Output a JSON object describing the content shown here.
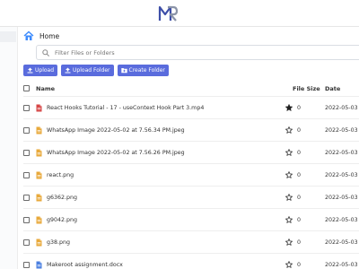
{
  "header": {
    "logo_text": "MR"
  },
  "breadcrumb": {
    "current": "Home"
  },
  "search": {
    "placeholder": "Filter Files or Folders"
  },
  "actions": {
    "upload": "Upload",
    "upload_folder": "Upload Folder",
    "create_folder": "Create Folder"
  },
  "table": {
    "headers": {
      "name": "Name",
      "size": "File Size",
      "date": "Date"
    },
    "rows": [
      {
        "name": "React Hooks Tutorial - 17 - useContext Hook Part 3.mp4",
        "type": "video",
        "starred": true,
        "size": "0",
        "date": "2022-05-03"
      },
      {
        "name": "WhatsApp Image 2022-05-02 at 7.56.34 PM.jpeg",
        "type": "image",
        "starred": false,
        "size": "0",
        "date": "2022-05-03"
      },
      {
        "name": "WhatsApp Image 2022-05-02 at 7.56.26 PM.jpeg",
        "type": "image",
        "starred": false,
        "size": "0",
        "date": "2022-05-03"
      },
      {
        "name": "react.png",
        "type": "image",
        "starred": false,
        "size": "0",
        "date": "2022-05-03"
      },
      {
        "name": "g6362.png",
        "type": "image",
        "starred": false,
        "size": "0",
        "date": "2022-05-03"
      },
      {
        "name": "g9042.png",
        "type": "image",
        "starred": false,
        "size": "0",
        "date": "2022-05-03"
      },
      {
        "name": "g38.png",
        "type": "image",
        "starred": false,
        "size": "0",
        "date": "2022-05-03"
      },
      {
        "name": "Makeroot assignment.docx",
        "type": "doc",
        "starred": false,
        "size": "0",
        "date": "2022-05-03"
      }
    ]
  },
  "colors": {
    "accent": "#5a6cdd",
    "video": "#d64545",
    "image": "#e8a93b",
    "doc": "#4a7fe0"
  }
}
